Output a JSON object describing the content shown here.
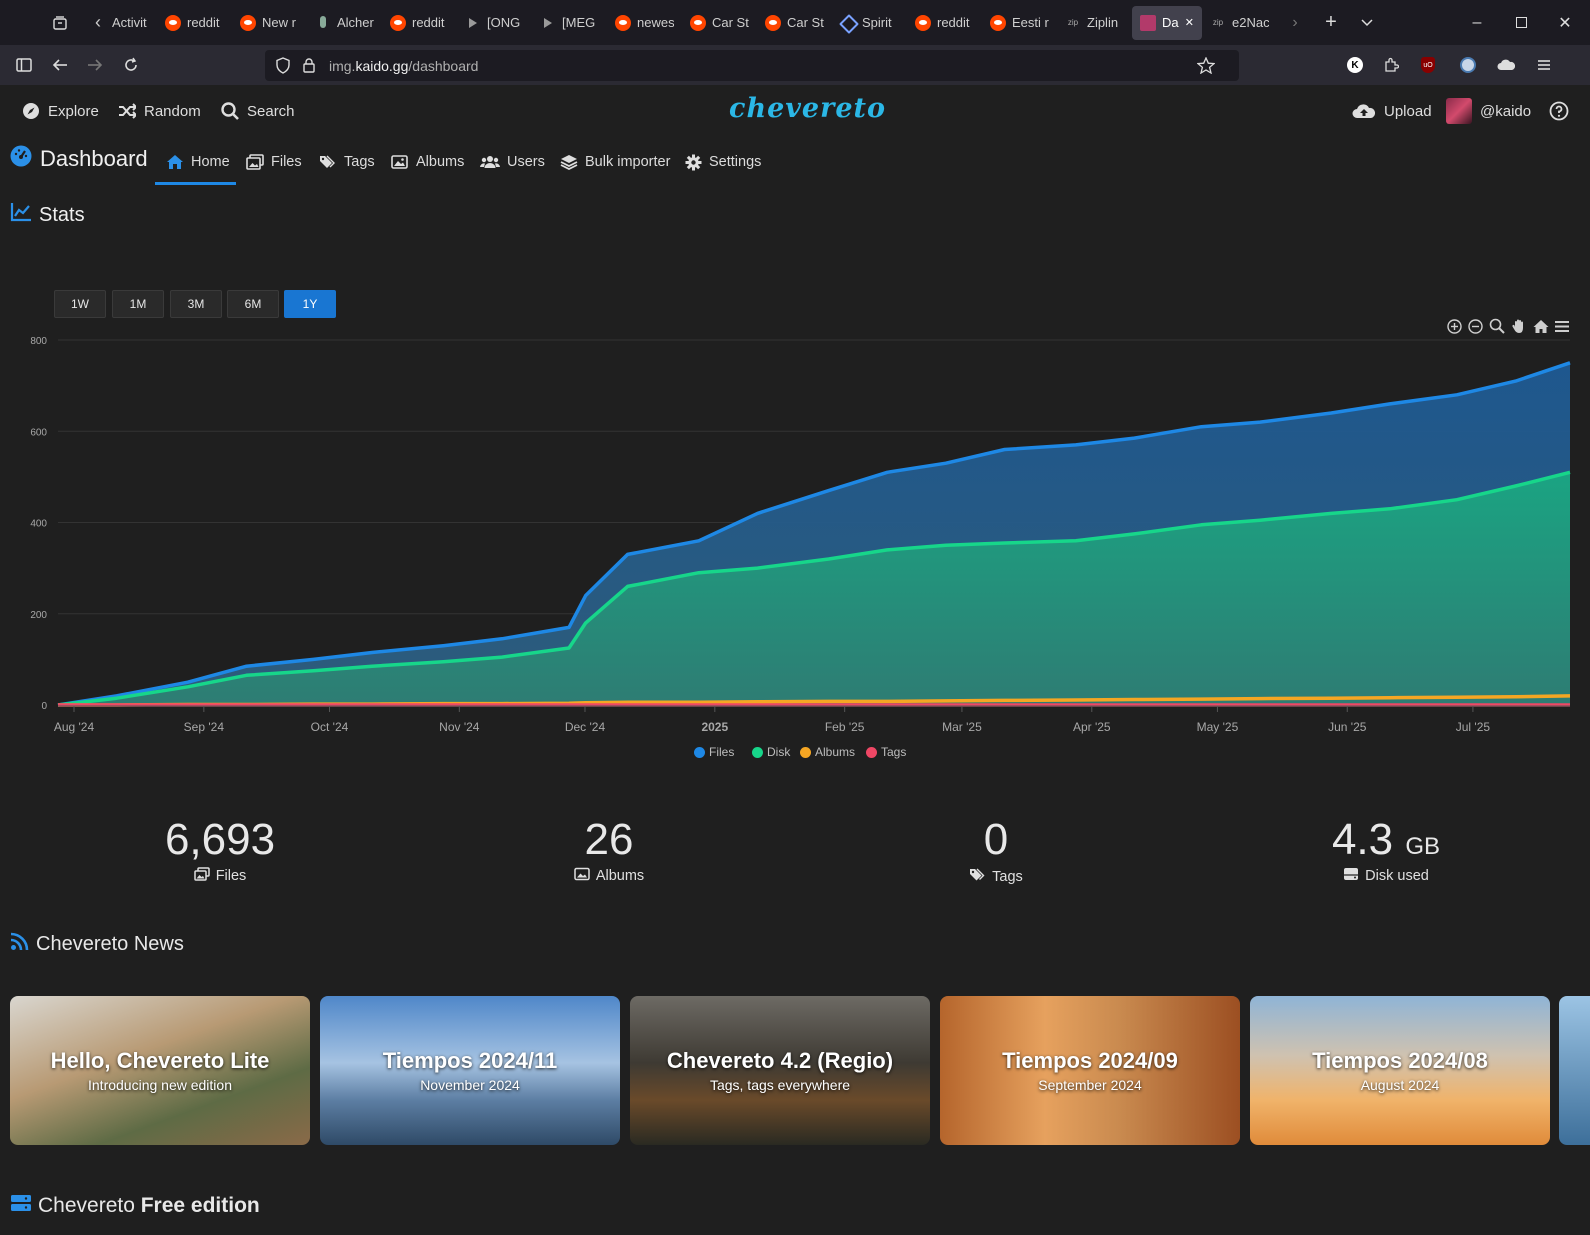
{
  "browser": {
    "tabs": [
      {
        "label": "Activit",
        "icon": "tab-back-icon"
      },
      {
        "label": "reddit",
        "icon": "reddit-icon"
      },
      {
        "label": "New r",
        "icon": "reddit-icon"
      },
      {
        "label": "Alcher",
        "icon": "alchemy-icon"
      },
      {
        "label": "reddit",
        "icon": "reddit-icon"
      },
      {
        "label": "[ONG",
        "icon": "play-icon"
      },
      {
        "label": "[MEG",
        "icon": "play-icon"
      },
      {
        "label": "newes",
        "icon": "reddit-icon"
      },
      {
        "label": "Car St",
        "icon": "reddit-icon"
      },
      {
        "label": "Car St",
        "icon": "reddit-icon"
      },
      {
        "label": "Spirit",
        "icon": "spirit-icon"
      },
      {
        "label": "reddit",
        "icon": "reddit-icon"
      },
      {
        "label": "Eesti r",
        "icon": "reddit-icon"
      },
      {
        "label": "Ziplin",
        "icon": "zip-icon"
      },
      {
        "label": "Das",
        "icon": "dashboard-favicon",
        "active": true
      },
      {
        "label": "e2Nac",
        "icon": "zip-icon"
      }
    ],
    "url_prefix": "img.",
    "url_domain": "kaido.gg",
    "url_path": "/dashboard"
  },
  "topnav": {
    "explore": "Explore",
    "random": "Random",
    "search": "Search",
    "logo": "chevereto",
    "upload": "Upload",
    "user": "@kaido"
  },
  "subnav": {
    "title": "Dashboard",
    "home": "Home",
    "files": "Files",
    "tags": "Tags",
    "albums": "Albums",
    "users": "Users",
    "bulk": "Bulk importer",
    "settings": "Settings"
  },
  "stats_title": "Stats",
  "ranges": [
    "1W",
    "1M",
    "3M",
    "6M",
    "1Y"
  ],
  "active_range": "1Y",
  "chart_data": {
    "type": "area",
    "y_ticks": [
      0,
      200,
      400,
      600,
      800
    ],
    "ylim": [
      0,
      800
    ],
    "x_tick_labels": [
      "Aug '24",
      "Sep '24",
      "Oct '24",
      "Nov '24",
      "Dec '24",
      "2025",
      "Feb '25",
      "Mar '25",
      "Apr '25",
      "May '25",
      "Jun '25",
      "Jul '25"
    ],
    "x": [
      "Aug 1",
      "Aug 15",
      "Sep 1",
      "Sep 15",
      "Oct 1",
      "Oct 15",
      "Nov 1",
      "Nov 15",
      "Dec 1",
      "Dec 5",
      "Dec 15",
      "Jan 1",
      "Jan 15",
      "Feb 1",
      "Feb 15",
      "Mar 1",
      "Mar 15",
      "Apr 1",
      "Apr 15",
      "May 1",
      "May 15",
      "Jun 1",
      "Jun 15",
      "Jul 1",
      "Jul 15",
      "Jul 28"
    ],
    "x_day": [
      0,
      14,
      31,
      45,
      61,
      75,
      92,
      106,
      122,
      126,
      136,
      153,
      167,
      184,
      198,
      212,
      226,
      243,
      257,
      273,
      287,
      304,
      318,
      334,
      348,
      361
    ],
    "x_day_max": 361,
    "series": [
      {
        "name": "Files",
        "color": "#1e88e5",
        "values": [
          0,
          20,
          50,
          85,
          100,
          115,
          130,
          145,
          170,
          240,
          330,
          360,
          420,
          470,
          510,
          530,
          560,
          570,
          585,
          610,
          620,
          640,
          660,
          680,
          710,
          750
        ]
      },
      {
        "name": "Disk",
        "color": "#17d68a",
        "values": [
          0,
          15,
          40,
          65,
          75,
          85,
          95,
          105,
          125,
          180,
          260,
          290,
          300,
          320,
          340,
          350,
          355,
          360,
          375,
          395,
          405,
          420,
          430,
          450,
          480,
          510
        ]
      },
      {
        "name": "Albums",
        "color": "#f5a623",
        "values": [
          0,
          0,
          1,
          1,
          2,
          2,
          3,
          3,
          4,
          5,
          6,
          6,
          7,
          8,
          8,
          9,
          10,
          11,
          12,
          13,
          14,
          15,
          16,
          17,
          18,
          20
        ]
      },
      {
        "name": "Tags",
        "color": "#ef4765",
        "values": [
          0,
          0,
          0,
          0,
          0,
          0,
          0,
          0,
          0,
          0,
          0,
          0,
          0,
          0,
          0,
          0,
          0,
          0,
          0,
          0,
          0,
          0,
          0,
          0,
          0,
          0
        ]
      }
    ],
    "legend": [
      "Files",
      "Disk",
      "Albums",
      "Tags"
    ],
    "legend_position": "bottom-center",
    "grid": true
  },
  "stats": [
    {
      "value": "6,693",
      "unit": "",
      "label": "Files",
      "icon": "files-icon"
    },
    {
      "value": "26",
      "unit": "",
      "label": "Albums",
      "icon": "albums-icon"
    },
    {
      "value": "0",
      "unit": "",
      "label": "Tags",
      "icon": "tags-icon"
    },
    {
      "value": "4.3",
      "unit": "GB",
      "label": "Disk used",
      "icon": "disk-icon"
    }
  ],
  "news_title": "Chevereto News",
  "news": [
    {
      "title": "Hello, Chevereto Lite",
      "subtitle": "Introducing new edition",
      "bg": "linear-gradient(160deg,#d9d6cf 0%,#b89a74 40%,#5e6b45 70%,#8a6a48 100%)"
    },
    {
      "title": "Tiempos 2024/11",
      "subtitle": "November 2024",
      "bg": "linear-gradient(180deg,#4f87c9 0%,#a6c3e2 45%,#5c7ea3 70%,#2f4a67 100%)"
    },
    {
      "title": "Chevereto 4.2 (Regio)",
      "subtitle": "Tags, tags everywhere",
      "bg": "linear-gradient(180deg,#6d6a64 0%,#3e3a33 45%,#6a4a2a 70%,#2a2a22 100%)"
    },
    {
      "title": "Tiempos 2024/09",
      "subtitle": "September 2024",
      "bg": "linear-gradient(90deg,#b5652c 0%,#e6a15e 35%,#c98a4f 60%,#9c4f22 100%)"
    },
    {
      "title": "Tiempos 2024/08",
      "subtitle": "August 2024",
      "bg": "linear-gradient(180deg,#8fb4d6 0%,#cfc2b0 40%,#f0b36a 70%,#e08b3a 100%)"
    }
  ],
  "free_edition": {
    "prefix": "Chevereto ",
    "bold": "Free edition"
  }
}
